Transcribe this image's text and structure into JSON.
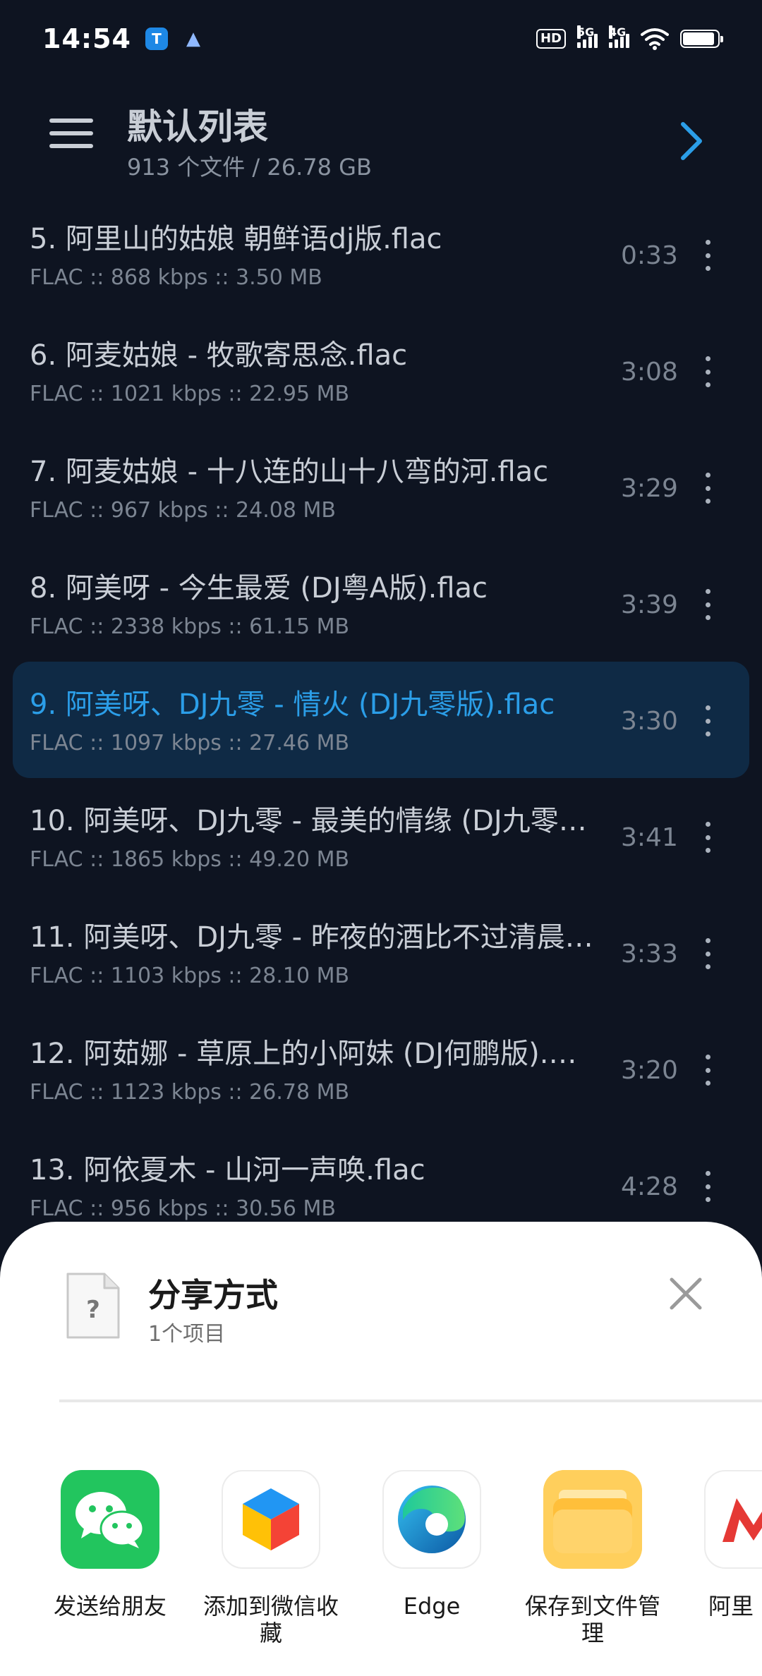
{
  "status_bar": {
    "time": "14:54",
    "hd_label": "HD",
    "sig1_label": "5G",
    "sig2_label": "4G"
  },
  "header": {
    "title": "默认列表",
    "subtitle": "913 个文件 / 26.78 GB"
  },
  "tracks": [
    {
      "title": "5. 阿里山的姑娘 朝鲜语dj版.flac",
      "meta": "FLAC :: 868 kbps :: 3.50 MB",
      "duration": "0:33"
    },
    {
      "title": "6. 阿麦姑娘 - 牧歌寄思念.flac",
      "meta": "FLAC :: 1021 kbps :: 22.95 MB",
      "duration": "3:08"
    },
    {
      "title": "7. 阿麦姑娘 - 十八连的山十八弯的河.flac",
      "meta": "FLAC :: 967 kbps :: 24.08 MB",
      "duration": "3:29"
    },
    {
      "title": "8. 阿美呀 - 今生最爱 (DJ粤A版).flac",
      "meta": "FLAC :: 2338 kbps :: 61.15 MB",
      "duration": "3:39"
    },
    {
      "title": "9. 阿美呀、DJ九零 - 情火 (DJ九零版).flac",
      "meta": "FLAC :: 1097 kbps :: 27.46 MB",
      "duration": "3:30"
    },
    {
      "title": "10. 阿美呀、DJ九零 - 最美的情缘 (DJ九零…",
      "meta": "FLAC :: 1865 kbps :: 49.20 MB",
      "duration": "3:41"
    },
    {
      "title": "11. 阿美呀、DJ九零 - 昨夜的酒比不过清晨…",
      "meta": "FLAC :: 1103 kbps :: 28.10 MB",
      "duration": "3:33"
    },
    {
      "title": "12. 阿茹娜 - 草原上的小阿妹 (DJ何鹏版).flac",
      "meta": "FLAC :: 1123 kbps :: 26.78 MB",
      "duration": "3:20"
    },
    {
      "title": "13. 阿依夏木 - 山河一声唤.flac",
      "meta": "FLAC :: 956 kbps :: 30.56 MB",
      "duration": "4:28"
    }
  ],
  "share": {
    "title": "分享方式",
    "count": "1个项目",
    "apps": [
      {
        "label": "发送给朋友",
        "icon": "wechat-icon"
      },
      {
        "label": "添加到微信收藏",
        "icon": "wechat-favorites-icon"
      },
      {
        "label": "Edge",
        "icon": "edge-icon"
      },
      {
        "label": "保存到文件管理",
        "icon": "file-manager-icon"
      },
      {
        "label": "阿里",
        "icon": "alibaba-icon"
      }
    ]
  },
  "colors": {
    "background": "#0e1421",
    "accent": "#2b9ee8",
    "active_row": "#0f2a45",
    "sheet": "#ffffff"
  }
}
